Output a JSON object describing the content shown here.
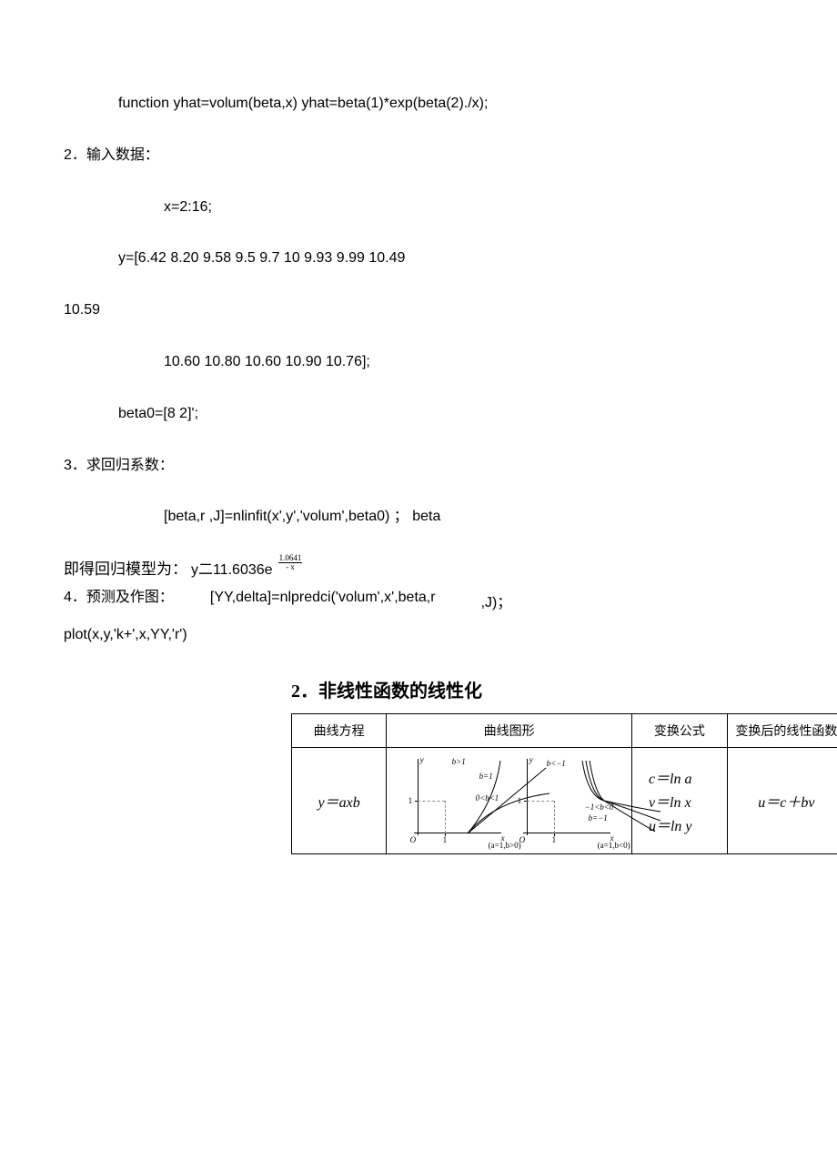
{
  "code": {
    "l1": "function yhat=volum(beta,x) yhat=beta(1)*exp(beta(2)./x);",
    "sec2": "2．输入数据：",
    "l2": "x=2:16;",
    "l3": "y=[6.42 8.20 9.58 9.5 9.7 10 9.93 9.99 10.49",
    "l4": "10.59",
    "l5": "10.60 10.80 10.60 10.90 10.76];",
    "l6": "beta0=[8 2]';",
    "sec3": "3．求回归系数：",
    "l7": "[beta,r ,J]=nlinfit(x',y','volum',beta0) ； beta",
    "model_prefix": "即得回归模型为：",
    "model_y": "y二11.6036e",
    "model_exp_num": "1.0641",
    "model_exp_x": "- x",
    "sec4": "4．预测及作图：",
    "l8": "[YY,delta]=nlpredci('volum',x',beta,r",
    "l8b": ",J)；",
    "l9": "plot(x,y,'k+',x,YY,'r')"
  },
  "section_title": "2．非线性函数的线性化",
  "table": {
    "h1": "曲线方程",
    "h2": "曲线图形",
    "h3": "变换公式",
    "h4": "变换后的线性函数",
    "r1c1": "y＝axb",
    "g1": {
      "b_gt_1": "b>1",
      "b_eq_1": "b=1",
      "b_0_1": "0<b<1",
      "caption": "(a=1,b>0)"
    },
    "g2": {
      "b_lt_m1": "b<−1",
      "b_m1_0": "−1<b<0",
      "b_eq_m1": "b=−1",
      "caption": "(a=1,b<0)"
    },
    "r1c3a": "c＝ln a",
    "r1c3b": "v＝ln x",
    "r1c3c": "u＝ln y",
    "r1c4": "u＝c＋bv"
  }
}
